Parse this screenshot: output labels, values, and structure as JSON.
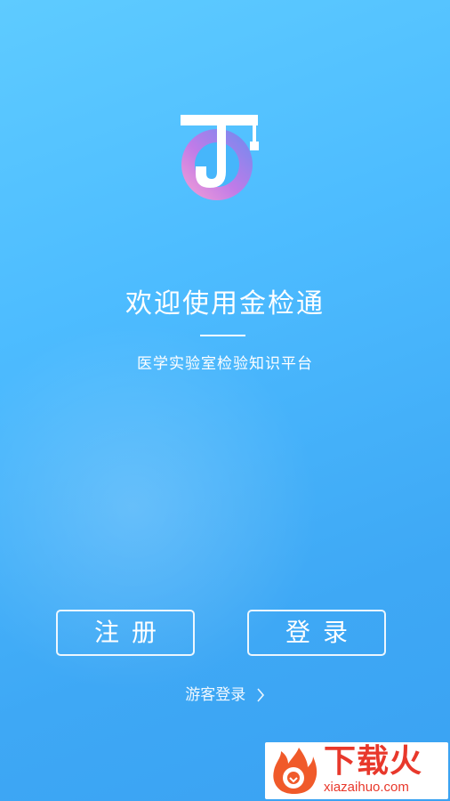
{
  "welcome": {
    "title": "欢迎使用金检通",
    "subtitle": "医学实验室检验知识平台"
  },
  "buttons": {
    "register": "注册",
    "login": "登录"
  },
  "guest": {
    "label": "游客登录"
  },
  "watermark": {
    "title": "下载火",
    "url": "xiazaihuo.com"
  },
  "colors": {
    "accent": "#4dbcff",
    "watermark_red": "#e8382b"
  },
  "icons": {
    "app_logo": "jjt-logo-icon",
    "guest_chevron": "chevron-right-icon",
    "watermark_logo": "flame-logo-icon"
  }
}
